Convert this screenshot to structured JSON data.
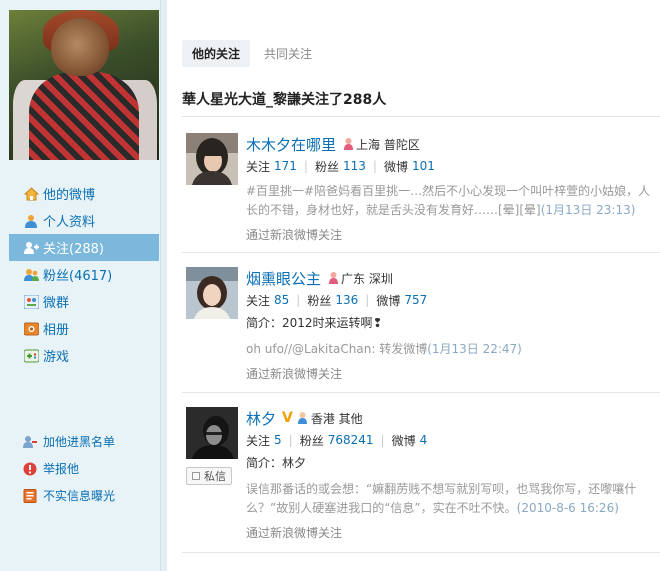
{
  "sidebar": {
    "nav": [
      {
        "label": "他的微博",
        "icon": "home-icon"
      },
      {
        "label": "个人资料",
        "icon": "profile-icon"
      },
      {
        "label": "关注(288)",
        "icon": "follow-icon"
      },
      {
        "label": "粉丝(4617)",
        "icon": "fans-icon"
      },
      {
        "label": "微群",
        "icon": "group-icon"
      },
      {
        "label": "相册",
        "icon": "album-icon"
      },
      {
        "label": "游戏",
        "icon": "game-icon"
      }
    ],
    "tools": [
      {
        "label": "加他进黑名单",
        "icon": "blacklist-icon"
      },
      {
        "label": "举报他",
        "icon": "report-icon"
      },
      {
        "label": "不实信息曝光",
        "icon": "rumor-icon"
      }
    ]
  },
  "tabs": {
    "active": "他的关注",
    "other": "共同关注"
  },
  "heading": "華人星光大道_黎謙关注了288人",
  "labels": {
    "follow": "关注",
    "fans": "粉丝",
    "weibo": "微博",
    "intro_prefix": "简介：",
    "via": "通过新浪微博关注",
    "dm": "私信"
  },
  "entries": [
    {
      "name": "木木夕在哪里",
      "gender": "female",
      "location": "上海 普陀区",
      "follow": "171",
      "fans": "113",
      "weibo": "101",
      "post_line1": "#百里挑一#陪爸妈看百里挑一…然后不小心发现一个叫叶梓萱的小姑娘，人",
      "post_line2_main": "长的不错，身材也好，就是舌头没有发育好……[晕][晕]",
      "post_time": "(1月13日 23:13)",
      "via": "通过新浪微博关注"
    },
    {
      "name": "烟熏眼公主",
      "gender": "female",
      "location": "广东 深圳",
      "follow": "85",
      "fans": "136",
      "weibo": "757",
      "intro": "2012时来运转啊❢",
      "post_main": "oh ufo//@LakitaChan: 转发微博",
      "post_time": "(1月13日 22:47)",
      "via": "通过新浪微博关注"
    },
    {
      "name": "林夕",
      "verified": "V",
      "gender": "male",
      "location": "香港 其他",
      "follow": "5",
      "fans": "768241",
      "weibo": "4",
      "intro": "林夕",
      "post_line1": "误信那番话的或会想：“嫲翻苈贱不想写就别写呗，也骂我你写，还嚟嚷什",
      "post_line2_main": "么？”故别人硬塞进我口的“信息”，实在不吐不快。",
      "post_time": "(2010-8-6 16:26)",
      "via": "通过新浪微博关注"
    }
  ],
  "colors": {
    "link": "#0a6fb4",
    "active_nav_bg": "#7cb8dc",
    "sidebar_bg": "#e8f3f8",
    "verified": "#f0a000"
  }
}
